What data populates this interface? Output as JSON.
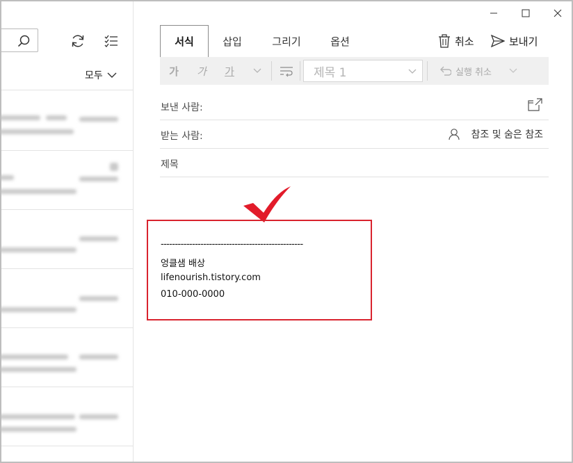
{
  "left_pane": {
    "filter_label": "모두"
  },
  "ribbon": {
    "tabs": [
      {
        "label": "서식"
      },
      {
        "label": "삽입"
      },
      {
        "label": "그리기"
      },
      {
        "label": "옵션"
      }
    ],
    "discard_label": "취소",
    "send_label": "보내기"
  },
  "toolbar": {
    "bold_label": "가",
    "italic_label": "가",
    "underline_label": "가",
    "style_value": "제목 1",
    "undo_label": "실행 취소"
  },
  "compose": {
    "from_label": "보낸 사람:",
    "to_label": "받는 사람:",
    "cc_bcc_label": "참조 및 숨은 참조",
    "subject_placeholder": "제목"
  },
  "signature": {
    "divider": "--------------------------------------------------",
    "name": "엉클샘 배상",
    "website": "lifenourish.tistory.com",
    "phone": "010-000-0000"
  },
  "colors": {
    "annotation_red": "#d9232e",
    "toolbar_bg": "#f0f0f0"
  }
}
